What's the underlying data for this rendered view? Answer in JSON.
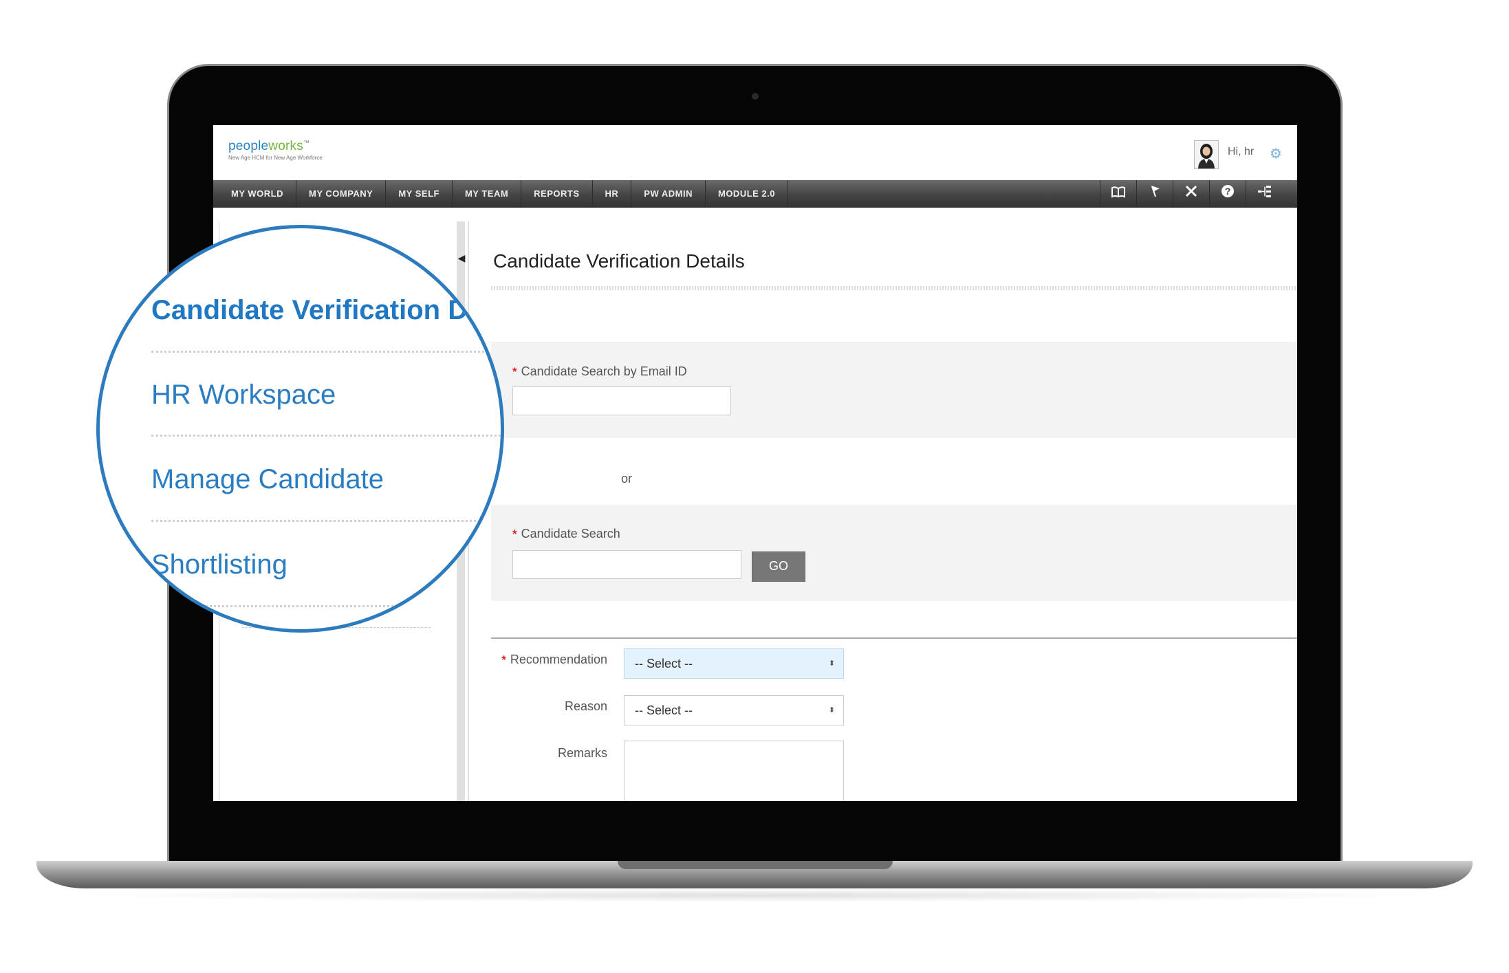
{
  "app": {
    "logo_text_a": "pe",
    "logo_text_b": "ople",
    "logo_text_c": "works",
    "logo_tm": "™",
    "logo_tagline": "New Age HCM for New Age Workforce",
    "user_greeting": "Hi, hr"
  },
  "nav": {
    "items": [
      "MY WORLD",
      "MY COMPANY",
      "MY SELF",
      "MY TEAM",
      "REPORTS",
      "HR",
      "PW ADMIN",
      "MODULE 2.0"
    ],
    "icons": [
      "book-icon",
      "flag-icon",
      "tools-icon",
      "help-icon",
      "sitemap-icon"
    ]
  },
  "sidebar": {
    "items": [
      {
        "label": "Candidate Verification D",
        "active": true
      },
      {
        "label": "HR Workspace",
        "active": false
      },
      {
        "label": "Manage Candidate",
        "active": false
      },
      {
        "label": "Shortlisting",
        "active": false
      }
    ]
  },
  "page": {
    "title": "Candidate Verification Details",
    "email_search_label": "Candidate Search by Email ID",
    "email_search_value": "",
    "or_text": "or",
    "candidate_search_label": "Candidate Search",
    "candidate_search_value": "",
    "go_label": "GO",
    "required_marker": "*",
    "recommendation_label": "Recommendation",
    "recommendation_value": "-- Select --",
    "reason_label": "Reason",
    "reason_value": "-- Select --",
    "remarks_label": "Remarks",
    "remarks_value": ""
  },
  "colors": {
    "accent": "#2c7bbf",
    "nav_bg": "#444444",
    "required": "#dd2222"
  }
}
